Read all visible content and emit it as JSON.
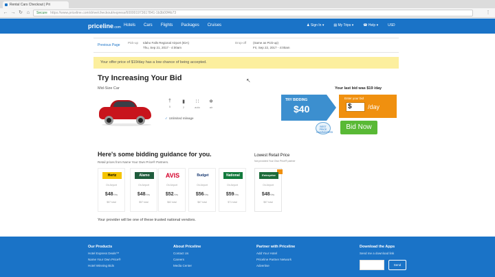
{
  "browser": {
    "tab_title": "Rental Cars Checkout | Pri",
    "secure_label": "Secure",
    "url": "https://www.priceline.com/drive/checkout/express/600001973617841-1b3b00f4b73"
  },
  "header": {
    "logo": "priceline",
    "logo_suffix": ".com",
    "nav": [
      "Hotels",
      "Cars",
      "Flights",
      "Packages",
      "Cruises"
    ],
    "right_nav": [
      "Sign In",
      "My Trips",
      "Help",
      "USD"
    ]
  },
  "trip": {
    "prev_link": "Previous Page",
    "pickup_label": "Pick-up",
    "pickup_location": "Idaho Falls Regional Airport (IDA)",
    "pickup_date": "Thu, Sep 21, 2017 - 4:00am",
    "dropoff_label": "Drop-off",
    "dropoff_location": "(Same as Pick-up)",
    "dropoff_date": "Fri, Sep 22, 2017 - 4:00am"
  },
  "warning": "Your offer price of $19/day has a low chance of being accepted.",
  "main": {
    "title": "Try Increasing Your Bid",
    "car_class": "Mid-Size Car",
    "features": [
      {
        "icon": "person-icon",
        "glyph": "†",
        "label": "5"
      },
      {
        "icon": "bag-icon",
        "glyph": "▮",
        "label": "2"
      },
      {
        "icon": "transmission-icon",
        "glyph": "∷",
        "label": "auto"
      },
      {
        "icon": "ac-icon",
        "glyph": "❄",
        "label": "air"
      }
    ],
    "mileage": "Unlimited mileage"
  },
  "bid": {
    "last_bid": "Your last bid was $19 /day",
    "try_label": "TRY BIDDING",
    "try_amount": "$40",
    "enter_label": "Enter your bid",
    "input_value": "$",
    "unit": "/day",
    "badge": "BEST PRICE GUARANTEED",
    "bid_now": "Bid Now"
  },
  "guidance": {
    "title": "Here's some bidding guidance for you.",
    "subtitle": "Retail prices from Name Your Own Price® Partners.",
    "lowest_title": "Lowest Retail Price",
    "lowest_subtitle": "Not provided Your Own Price® partner",
    "vendors": [
      {
        "name": "Hertz",
        "color": "#f5c400",
        "text_color": "#000",
        "instance": "On Airport",
        "price": "$48",
        "unit": "/day",
        "total": "$57 total"
      },
      {
        "name": "Alamo",
        "color": "#1f5c3c",
        "text_color": "#fff",
        "instance": "On Airport",
        "price": "$48",
        "unit": "/day",
        "total": "$57 total"
      },
      {
        "name": "AVIS",
        "color": "#ffffff",
        "text_color": "#d4002a",
        "instance": "On Airport",
        "price": "$52",
        "unit": "/day",
        "total": "$62 total"
      },
      {
        "name": "Budget",
        "color": "#ffffff",
        "text_color": "#1a3b73",
        "instance": "On Airport",
        "price": "$56",
        "unit": "/day",
        "total": "$67 total"
      },
      {
        "name": "National",
        "color": "#127a3c",
        "text_color": "#fff",
        "instance": "On Airport",
        "price": "$59",
        "unit": "/day",
        "total": "$71 total"
      }
    ],
    "lowest_vendor": {
      "name": "Enterprise",
      "color": "#1d6b3a",
      "text_color": "#fff",
      "instance": "On Airport",
      "price": "$48",
      "unit": "/day",
      "total": "$57 total"
    },
    "trusted": "Your provider will be one of these trusted national vendors."
  },
  "footer": {
    "columns": [
      {
        "title": "Our Products",
        "links": [
          "Hotel Express Deals™",
          "Name Your Own Price®",
          "Hotel Winning Bids"
        ]
      },
      {
        "title": "About Priceline",
        "links": [
          "Contact Us",
          "Careers",
          "Media Center"
        ]
      },
      {
        "title": "Partner with Priceline",
        "links": [
          "Add Your Hotel",
          "Priceline Partner Network",
          "Advertise"
        ]
      },
      {
        "title": "Download the Apps",
        "links": [
          "Send me a download link"
        ]
      }
    ],
    "send_label": "Send"
  },
  "colors": {
    "brand_blue": "#1a73c7",
    "bid_orange": "#f0900f",
    "bid_green": "#59b935",
    "warning_yellow": "#fcef9e"
  }
}
